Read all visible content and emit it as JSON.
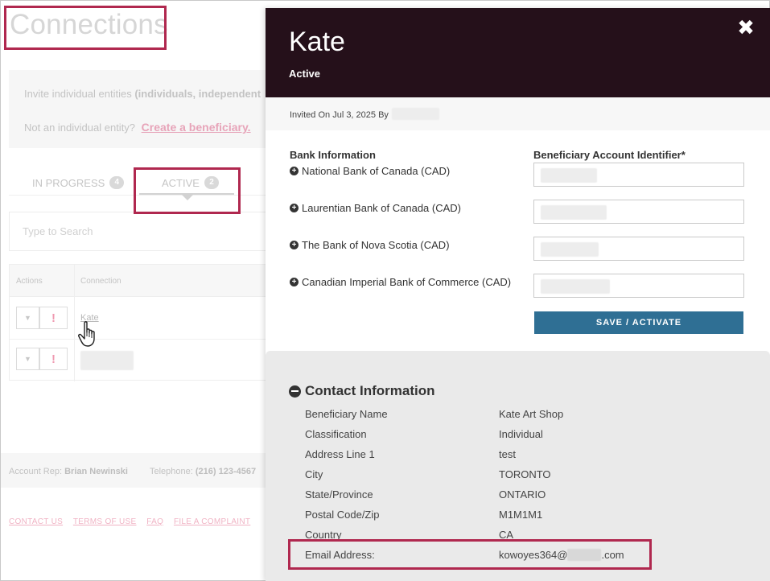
{
  "background": {
    "title": "Connections",
    "invite": {
      "line1_text": "Invite individual entities",
      "line1_bold": "(individuals, independent",
      "line2_text": "Not an individual entity?",
      "line2_link": "Create a beneficiary."
    },
    "tabs": [
      {
        "label": "IN PROGRESS",
        "count": "4"
      },
      {
        "label": "ACTIVE",
        "count": "2"
      }
    ],
    "search": {
      "placeholder": "Type to Search"
    },
    "table": {
      "headers": {
        "actions": "Actions",
        "connection": "Connection"
      },
      "rows": [
        {
          "connection": "Kate"
        },
        {
          "connection": ""
        }
      ],
      "warn_symbol": "!",
      "dropdown_symbol": "▼"
    },
    "footer": {
      "rep_label": "Account Rep:",
      "rep_name": "Brian Newinski",
      "tel_label": "Telephone:",
      "tel_value": "(216) 123-4567",
      "links": [
        "CONTACT US",
        "TERMS OF USE",
        "FAQ",
        "FILE A COMPLAINT"
      ]
    }
  },
  "modal": {
    "name": "Kate",
    "status": "Active",
    "close_symbol": "✖",
    "invited_text": "Invited On Jul 3, 2025 By",
    "bank_section_title": "Bank Information",
    "account_section_title": "Beneficiary Account Identifier*",
    "banks": [
      {
        "name": "National Bank of Canada (CAD)"
      },
      {
        "name": "Laurentian Bank of Canada (CAD)"
      },
      {
        "name": "The Bank of Nova Scotia (CAD)"
      },
      {
        "name": "Canadian Imperial Bank of Commerce (CAD)"
      }
    ],
    "save_label": "SAVE / ACTIVATE",
    "contact": {
      "title": "Contact Information",
      "fields": [
        {
          "label": "Beneficiary Name",
          "value": "Kate Art Shop"
        },
        {
          "label": "Classification",
          "value": "Individual"
        },
        {
          "label": "Address Line 1",
          "value": "test"
        },
        {
          "label": "City",
          "value": "TORONTO"
        },
        {
          "label": "State/Province",
          "value": "ONTARIO"
        },
        {
          "label": "Postal Code/Zip",
          "value": "M1M1M1"
        },
        {
          "label": "Country",
          "value": "CA"
        },
        {
          "label": "Email Address:",
          "value_prefix": "kowoyes364@",
          "value_suffix": ".com"
        }
      ]
    }
  },
  "colors": {
    "header_bg": "#25101a",
    "save_button": "#2f6f94",
    "highlight": "#b0284f",
    "link_pink": "#e7a4b9"
  }
}
